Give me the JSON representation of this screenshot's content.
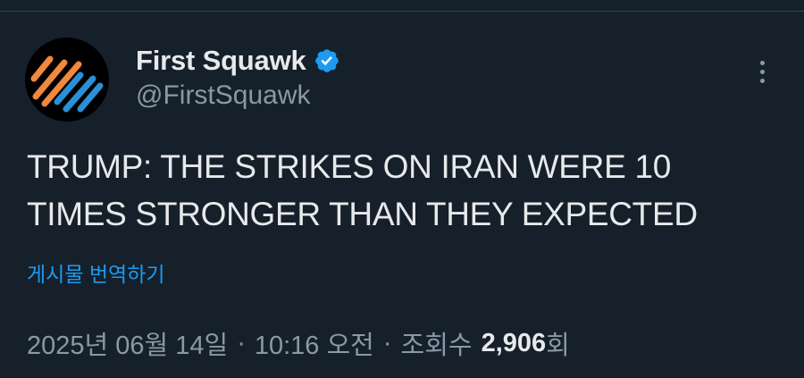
{
  "author": {
    "display_name": "First Squawk",
    "handle": "@FirstSquawk",
    "verified": true,
    "avatar_icon": "first-squawk-logo-icon",
    "verified_icon": "verified-badge-icon",
    "more_icon": "more-options-icon"
  },
  "tweet": {
    "text_line1": "TRUMP: THE STRIKES ON IRAN WERE 10",
    "text_line2": "TIMES STRONGER THAN THEY EXPECTED",
    "translate_label": "게시물 번역하기"
  },
  "meta": {
    "date": "2025년 06월 14일",
    "separator": "·",
    "time": "10:16 오전",
    "views_label": "조회수",
    "views_count": "2,906",
    "views_suffix": "회"
  },
  "colors": {
    "background": "#15202b",
    "text_primary": "#e7e9ea",
    "text_secondary": "#8b98a5",
    "link": "#1d9bf0",
    "verified": "#1d9bf0",
    "logo_orange": "#f0883e",
    "logo_blue": "#2b8fd6"
  }
}
